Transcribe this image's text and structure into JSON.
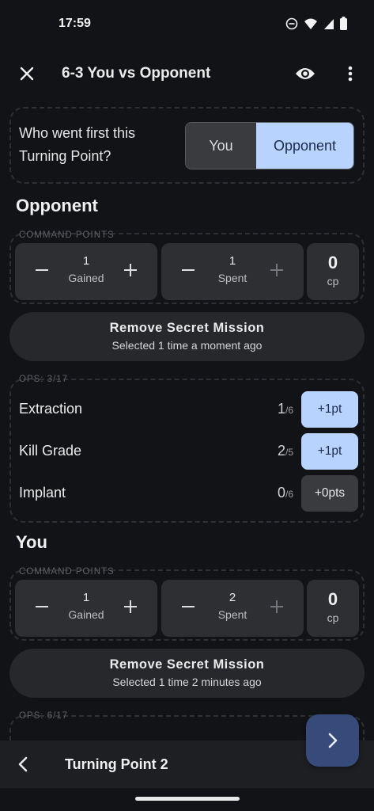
{
  "status_bar": {
    "time": "17:59"
  },
  "app_bar": {
    "title": "6-3 You vs Opponent"
  },
  "first_player": {
    "question": "Who went first this Turning Point?",
    "options": [
      "You",
      "Opponent"
    ],
    "selected": "Opponent"
  },
  "opponent": {
    "title": "Opponent",
    "cp_label": "COMMAND POINTS",
    "gained": {
      "value": "1",
      "label": "Gained"
    },
    "spent": {
      "value": "1",
      "label": "Spent"
    },
    "total": {
      "value": "0",
      "unit": "cp"
    },
    "mission": {
      "title": "Remove Secret Mission",
      "subtitle": "Selected 1 time a moment ago"
    },
    "ops_label": "OPS: 3/17",
    "ops": [
      {
        "name": "Extraction",
        "count": "1",
        "max": "/6",
        "button": "+1pt",
        "active": true
      },
      {
        "name": "Kill Grade",
        "count": "2",
        "max": "/5",
        "button": "+1pt",
        "active": true
      },
      {
        "name": "Implant",
        "count": "0",
        "max": "/6",
        "button": "+0pts",
        "active": false
      }
    ]
  },
  "you": {
    "title": "You",
    "cp_label": "COMMAND POINTS",
    "gained": {
      "value": "1",
      "label": "Gained"
    },
    "spent": {
      "value": "2",
      "label": "Spent"
    },
    "total": {
      "value": "0",
      "unit": "cp"
    },
    "mission": {
      "title": "Remove Secret Mission",
      "subtitle": "Selected 1 time 2 minutes ago"
    },
    "ops_label": "OPS: 6/17"
  },
  "bottom_bar": {
    "title": "Turning Point 2"
  },
  "colors": {
    "accent": "#b9d3ff",
    "fab": "#364b79",
    "background": "#121316",
    "card": "#2e2f33"
  }
}
